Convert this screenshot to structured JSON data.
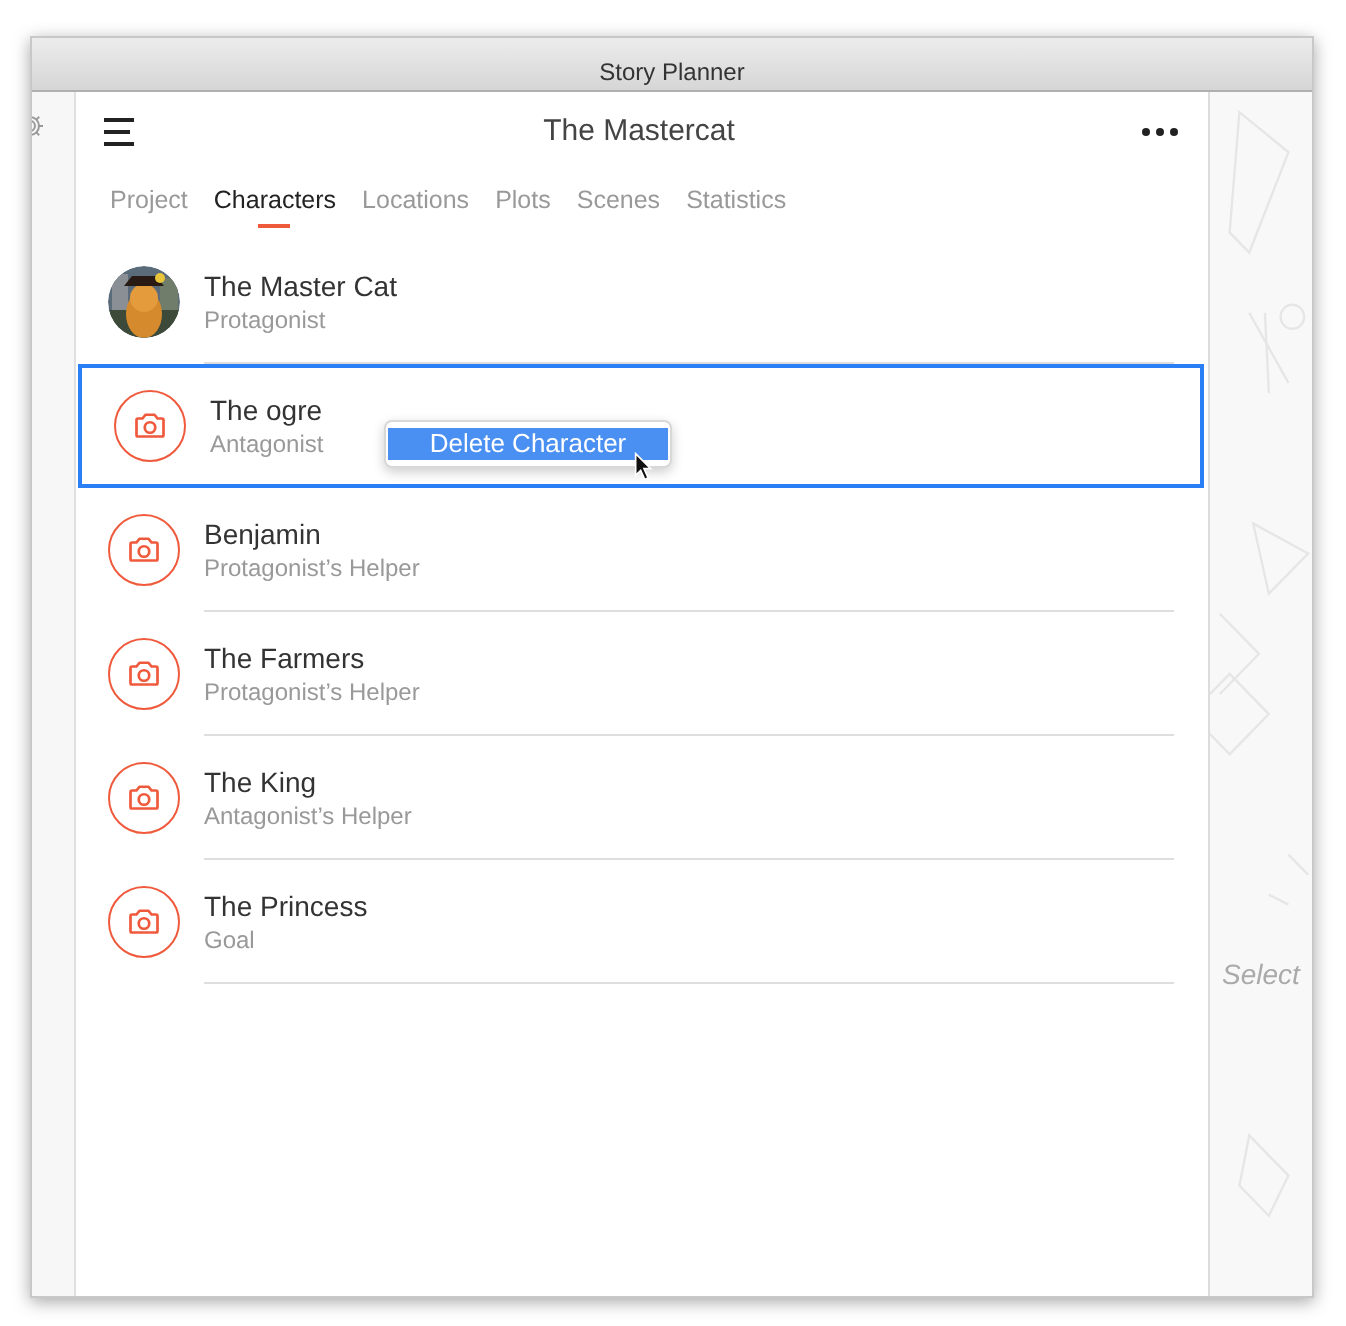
{
  "window": {
    "title": "Story Planner"
  },
  "header": {
    "title": "The Mastercat"
  },
  "tabs": [
    {
      "label": "Project",
      "selected": false
    },
    {
      "label": "Characters",
      "selected": true
    },
    {
      "label": "Locations",
      "selected": false
    },
    {
      "label": "Plots",
      "selected": false
    },
    {
      "label": "Scenes",
      "selected": false
    },
    {
      "label": "Statistics",
      "selected": false
    }
  ],
  "characters": [
    {
      "name": "The Master Cat",
      "role": "Protagonist",
      "kind": "picture",
      "selected": false
    },
    {
      "name": "The ogre",
      "role": "Antagonist",
      "kind": "placeholder",
      "selected": true
    },
    {
      "name": "Benjamin",
      "role": "Protagonist’s Helper",
      "kind": "placeholder",
      "selected": false
    },
    {
      "name": "The Farmers",
      "role": "Protagonist’s Helper",
      "kind": "placeholder",
      "selected": false
    },
    {
      "name": "The King",
      "role": "Antagonist’s Helper",
      "kind": "placeholder",
      "selected": false
    },
    {
      "name": "The Princess",
      "role": "Goal",
      "kind": "placeholder",
      "selected": false
    }
  ],
  "context_menu": {
    "items": [
      {
        "label": "Delete Character",
        "selected": true
      }
    ]
  },
  "detail_panel": {
    "hint": "Select"
  }
}
